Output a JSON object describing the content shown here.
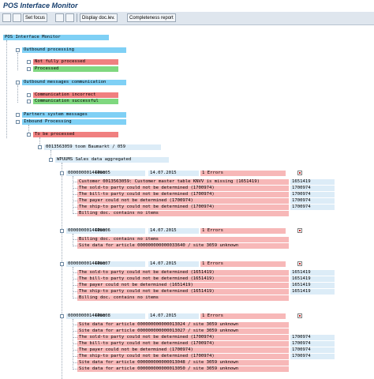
{
  "title": "POS Interface Monitor",
  "toolbar": {
    "set_focus": "Set focus",
    "display_doc_lev": "Display doc.lev.",
    "completeness_report": "Completeness report"
  },
  "tree": {
    "root": "POS Interface Monitor",
    "outbound_processing": "Outbound processing",
    "not_fully_processed": "Not fully processed",
    "processed": "Processed",
    "outbound_messages_communication": "Outbound messages communication",
    "communication_incorrect": "Communication incorrect",
    "communication_successful": "Communication successful",
    "partners_system_messages": "Partners system messages",
    "inbound_processing": "Inbound Processing",
    "to_be_processed": "To be processed",
    "store": "0013563059 toom Baumarkt / 059",
    "wpuums": "WPUUMS Sales data aggregated"
  },
  "idocs": [
    {
      "number": "0000000014449005",
      "type": "IDoc",
      "date": "14.07.2015",
      "errors": "1 Errors",
      "messages": [
        {
          "text": "Customer 0013563059: Customer master table KNVV is missing (1651419)",
          "value": "1651419"
        },
        {
          "text": "The sold-to party could not be determined (1700974)",
          "value": "1700974"
        },
        {
          "text": "The bill-to party could not be determined (1700974)",
          "value": "1700974"
        },
        {
          "text": "The payer could not be determined (1700974)",
          "value": "1700974"
        },
        {
          "text": "The ship-to party could not be determined (1700974)",
          "value": "1700974"
        },
        {
          "text": "Billing doc. contains no items",
          "value": ""
        }
      ]
    },
    {
      "number": "0000000014449006",
      "type": "IDoc",
      "date": "14.07.2015",
      "errors": "1 Errors",
      "messages": [
        {
          "text": "Billing doc. contains no items",
          "value": ""
        },
        {
          "text": "Site data for article 000000000000033640 / site 3059 unknown",
          "value": ""
        }
      ]
    },
    {
      "number": "0000000014449007",
      "type": "IDoc",
      "date": "14.07.2015",
      "errors": "1 Errors",
      "messages": [
        {
          "text": "The sold-to party could not be determined (1651419)",
          "value": "1651419"
        },
        {
          "text": "The bill-to party could not be determined (1651419)",
          "value": "1651419"
        },
        {
          "text": "The payer could not be determined (1651419)",
          "value": "1651419"
        },
        {
          "text": "The ship-to party could not be determined (1651419)",
          "value": "1651419"
        },
        {
          "text": "Billing doc. contains no items",
          "value": ""
        }
      ]
    },
    {
      "number": "0000000014449008",
      "type": "IDoc",
      "date": "14.07.2015",
      "errors": "1 Errors",
      "messages": [
        {
          "text": "Site data for article 000000000000013024 / site 3059 unknown",
          "value": ""
        },
        {
          "text": "Site data for article 000000000000013027 / site 3059 unknown",
          "value": ""
        },
        {
          "text": "The sold-to party could not be determined (1700974)",
          "value": "1700974"
        },
        {
          "text": "The bill-to party could not be determined (1700974)",
          "value": "1700974"
        },
        {
          "text": "The payer could not be determined (1700974)",
          "value": "1700974"
        },
        {
          "text": "The ship-to party could not be determined (1700974)",
          "value": "1700974"
        },
        {
          "text": "Site data for article 000000000000013048 / site 3059 unknown",
          "value": ""
        },
        {
          "text": "Site data for article 000000000000013050 / site 3059 unknown",
          "value": ""
        }
      ]
    }
  ]
}
